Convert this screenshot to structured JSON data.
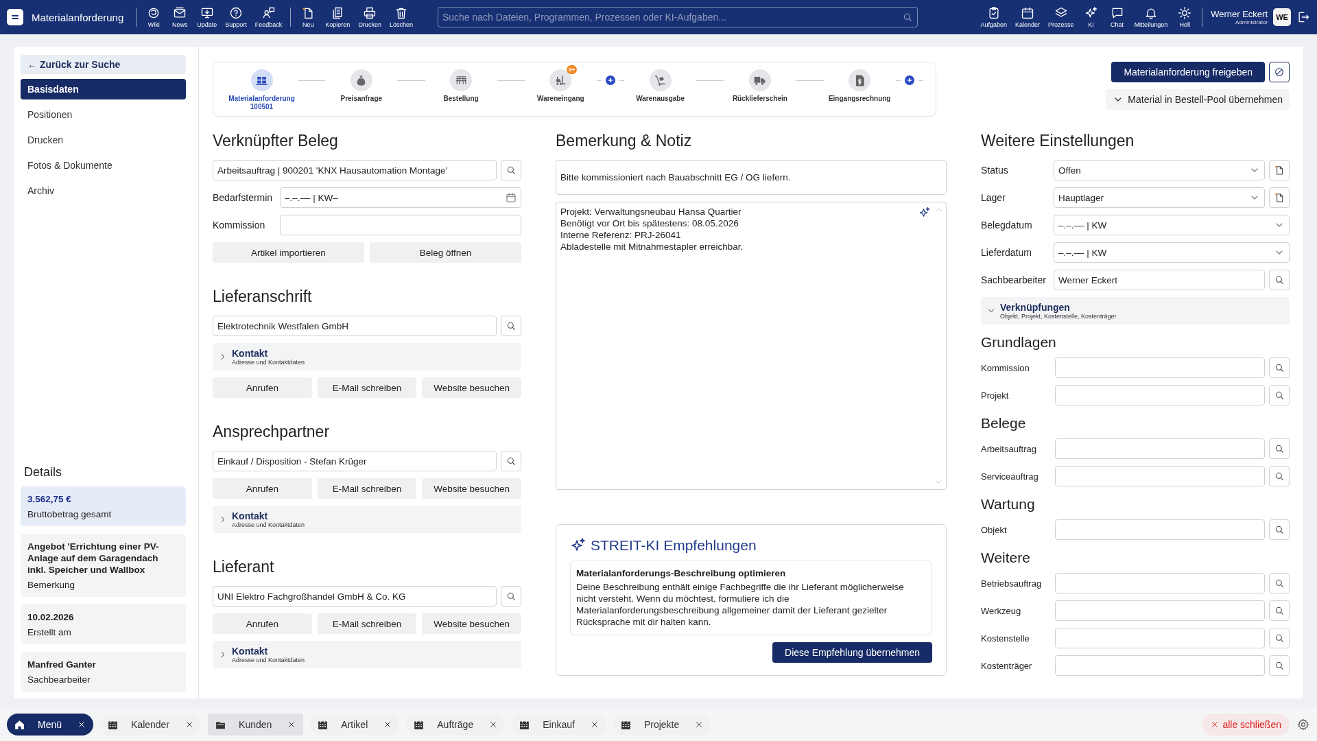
{
  "app_bar": {
    "title": "Materialanforderung",
    "tool_groups": [
      {
        "items": [
          {
            "label": "Wiki"
          },
          {
            "label": "News"
          },
          {
            "label": "Update"
          },
          {
            "label": "Support"
          },
          {
            "label": "Feedback"
          }
        ]
      },
      {
        "items": [
          {
            "label": "Neu"
          },
          {
            "label": "Kopieren"
          },
          {
            "label": "Drucken"
          },
          {
            "label": "Löschen"
          }
        ]
      }
    ],
    "search": {
      "placeholder": "Suche nach Dateien, Programmen, Prozessen oder KI-Aufgaben..."
    },
    "right_tools": [
      {
        "label": "Aufgaben"
      },
      {
        "label": "Kalender"
      },
      {
        "label": "Prozesse"
      },
      {
        "label": "KI"
      },
      {
        "label": "Chat"
      },
      {
        "label": "Mitteilungen"
      },
      {
        "label": "Hell"
      }
    ],
    "user": {
      "name": "Werner Eckert",
      "role": "Administrator",
      "initials": "WE"
    }
  },
  "sidebar": {
    "back_link": "← Zurück zur Suche",
    "items": [
      {
        "label": "Basisdaten",
        "selected": true
      },
      {
        "label": "Positionen",
        "selected": false
      },
      {
        "label": "Drucken",
        "selected": false
      },
      {
        "label": "Fotos & Dokumente",
        "selected": false
      },
      {
        "label": "Archiv",
        "selected": false
      }
    ],
    "details_title": "Details",
    "details": [
      {
        "value": "3.562,75 €",
        "label": "Bruttobetrag gesamt",
        "highlighted": true
      },
      {
        "value": "Angebot 'Errichtung einer PV-Anlage auf dem Garagendach inkl. Speicher und Wallbox",
        "label": "Bemerkung",
        "highlighted": false
      },
      {
        "value": "10.02.2026",
        "label": "Erstellt am",
        "highlighted": false
      },
      {
        "value": "Manfred Ganter",
        "label": "Sachbearbeiter",
        "highlighted": false
      }
    ]
  },
  "stepper": {
    "steps": [
      {
        "label": "Materialanforderung",
        "number": "100501",
        "selected": true,
        "add_after": false
      },
      {
        "label": "Preisanfrage",
        "selected": false,
        "add_after": false
      },
      {
        "label": "Bestellung",
        "selected": false,
        "add_after": false
      },
      {
        "label": "Wareneingang",
        "badge": "8+",
        "selected": false,
        "add_after": true
      },
      {
        "label": "Warenausgabe",
        "selected": false,
        "add_after": false
      },
      {
        "label": "Rücklieferschein",
        "selected": false,
        "add_after": false
      },
      {
        "label": "Eingangsrechnung",
        "selected": false,
        "add_after": true
      }
    ]
  },
  "actions": {
    "primary": "Materialanforderung freigeben",
    "pool_menu": "Material in Bestell-Pool übernehmen"
  },
  "linked_sections": [
    {
      "title": "Verknüpfter Beleg",
      "blocks": [
        {
          "kind": "lookup",
          "value": "Arbeitsauftrag | 900201 'KNX Hausautomation Montage'"
        },
        {
          "kind": "date",
          "label": "Bedarfstermin",
          "value": "–.–.–– | KW–"
        },
        {
          "kind": "text",
          "label": "Kommission"
        },
        {
          "kind": "buttons",
          "buttons": [
            "Artikel importieren",
            "Beleg öffnen"
          ]
        }
      ]
    },
    {
      "title": "Lieferanschrift",
      "blocks": [
        {
          "kind": "lookup",
          "value": "Elektrotechnik Westfalen GmbH"
        },
        {
          "kind": "expander",
          "title": "Kontakt",
          "subtitle": "Adresse und Kontaktdaten",
          "expanded": false
        },
        {
          "kind": "buttons",
          "buttons": [
            "Anrufen",
            "E-Mail schreiben",
            "Website besuchen"
          ]
        }
      ]
    },
    {
      "title": "Ansprechpartner",
      "blocks": [
        {
          "kind": "lookup",
          "value": "Einkauf / Disposition - Stefan Krüger"
        },
        {
          "kind": "buttons",
          "buttons": [
            "Anrufen",
            "E-Mail schreiben",
            "Website besuchen"
          ]
        },
        {
          "kind": "expander",
          "title": "Kontakt",
          "subtitle": "Adresse und Kontaktdaten",
          "expanded": false
        }
      ]
    },
    {
      "title": "Lieferant",
      "blocks": [
        {
          "kind": "lookup",
          "value": "UNI Elektro Fachgroßhandel GmbH & Co. KG"
        },
        {
          "kind": "buttons",
          "buttons": [
            "Anrufen",
            "E-Mail schreiben",
            "Website besuchen"
          ]
        },
        {
          "kind": "expander",
          "title": "Kontakt",
          "subtitle": "Adresse und Kontaktdaten",
          "expanded": false
        }
      ]
    }
  ],
  "note": {
    "title": "Bemerkung & Notiz",
    "summary": "Bitte kommissioniert nach Bauabschnitt EG / OG liefern.",
    "text_lines": [
      "Projekt: Verwaltungsneubau Hansa Quartier",
      "Benötigt vor Ort bis spätestens: 08.05.2026",
      "Interne Referenz: PRJ-26041",
      "Abladestelle mit Mitnahmestapler erreichbar."
    ]
  },
  "ai_card": {
    "title": "STREIT-KI Empfehlungen",
    "suggestion_title": "Materialanforderungs-Beschreibung optimieren",
    "suggestion_text": "Deine Beschreibung enthält einige Fachbegriffe die ihr Lieferant möglicherweise nicht versteht. Wenn du möchtest, formuliere ich die Materialanforderungsbeschreibung allgemeiner damit der Lieferant gezielter Rücksprache mit dir halten kann.",
    "button": "Diese Empfehlung übernehmen"
  },
  "settings": {
    "title": "Weitere Einstellungen",
    "rows": [
      {
        "kind": "select_new",
        "label": "Status",
        "value": "Offen"
      },
      {
        "kind": "select_new",
        "label": "Lager",
        "value": "Hauptlager"
      },
      {
        "kind": "date_select",
        "label": "Belegdatum",
        "value": "–.–.–– | KW"
      },
      {
        "kind": "date_select",
        "label": "Lieferdatum",
        "value": "–.–.–– | KW"
      },
      {
        "kind": "lookup",
        "label": "Sachbearbeiter",
        "value": "Werner Eckert"
      }
    ],
    "links": {
      "title": "Verknüpfungen",
      "subtitle": "Objekt, Projekt, Kostenstelle, Kostenträger",
      "expanded": true
    },
    "groups": [
      {
        "title": "Grundlagen",
        "fields": [
          {
            "label": "Kommission"
          },
          {
            "label": "Projekt"
          }
        ]
      },
      {
        "title": "Belege",
        "fields": [
          {
            "label": "Arbeitsauftrag"
          },
          {
            "label": "Serviceauftrag"
          }
        ]
      },
      {
        "title": "Wartung",
        "fields": [
          {
            "label": "Objekt"
          }
        ]
      },
      {
        "title": "Weitere",
        "fields": [
          {
            "label": "Betriebsauftrag"
          },
          {
            "label": "Werkzeug"
          },
          {
            "label": "Kostenstelle"
          },
          {
            "label": "Kostenträger"
          }
        ]
      }
    ]
  },
  "taskbar": {
    "tabs": [
      {
        "label": "Menü",
        "selected": true,
        "highlighted": false
      },
      {
        "label": "Kalender",
        "selected": false,
        "highlighted": false
      },
      {
        "label": "Kunden",
        "selected": false,
        "highlighted": true
      },
      {
        "label": "Artikel",
        "selected": false,
        "highlighted": false
      },
      {
        "label": "Aufträge",
        "selected": false,
        "highlighted": false
      },
      {
        "label": "Einkauf",
        "selected": false,
        "highlighted": false
      },
      {
        "label": "Projekte",
        "selected": false,
        "highlighted": false
      }
    ],
    "close_all": "alle schließen"
  }
}
